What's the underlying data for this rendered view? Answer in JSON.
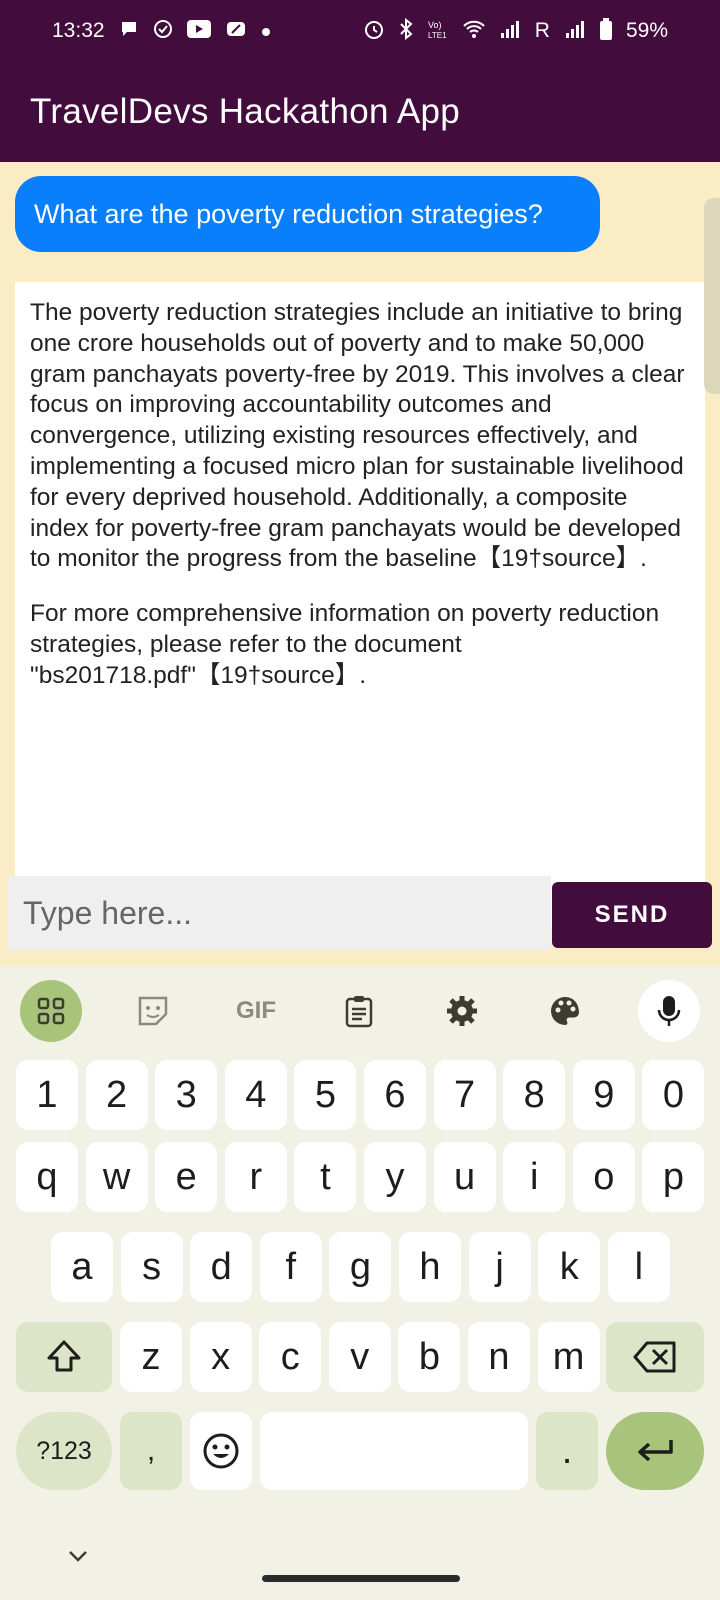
{
  "status_bar": {
    "time": "13:32",
    "battery": "59%",
    "carrier_r": "R",
    "left_icons": [
      "chat-icon",
      "check-icon",
      "youtube-icon",
      "app-icon",
      "dot-icon"
    ],
    "right_icons": [
      "alarm-icon",
      "bluetooth-icon",
      "volte-icon",
      "wifi-icon",
      "signal-icon",
      "signal-icon",
      "battery-icon"
    ]
  },
  "app": {
    "title": "TravelDevs Hackathon App"
  },
  "chat": {
    "user_message": "What are the poverty reduction strategies?",
    "answer_paragraph_1": "The poverty reduction strategies include an initiative to bring one crore households out of poverty and to make 50,000 gram panchayats poverty-free by 2019. This involves a clear focus on improving accountability outcomes and convergence, utilizing existing resources effectively, and implementing a focused micro plan for sustainable livelihood for every deprived household. Additionally, a composite index for poverty-free gram panchayats would be developed to monitor the progress from the baseline【19†source】.",
    "answer_paragraph_2": "For more comprehensive information on poverty reduction strategies, please refer to the document \"bs201718.pdf\"【19†source】."
  },
  "input": {
    "placeholder": "Type here...",
    "value": "",
    "send_label": "SEND"
  },
  "keyboard": {
    "toolbar": [
      "apps-icon",
      "sticker-icon",
      "GIF",
      "clipboard-icon",
      "settings-icon",
      "palette-icon",
      "mic-icon"
    ],
    "row_numbers": [
      "1",
      "2",
      "3",
      "4",
      "5",
      "6",
      "7",
      "8",
      "9",
      "0"
    ],
    "row_1": [
      "q",
      "w",
      "e",
      "r",
      "t",
      "y",
      "u",
      "i",
      "o",
      "p"
    ],
    "row_2": [
      "a",
      "s",
      "d",
      "f",
      "g",
      "h",
      "j",
      "k",
      "l"
    ],
    "row_3": [
      "z",
      "x",
      "c",
      "v",
      "b",
      "n",
      "m"
    ],
    "symbols_label": "?123",
    "comma": ",",
    "period": "."
  },
  "colors": {
    "app_bar": "#420d3d",
    "chat_background": "#faedc6",
    "user_bubble": "#0a7ffb",
    "send_button": "#420d3d",
    "keyboard_accent": "#a8c47a"
  }
}
